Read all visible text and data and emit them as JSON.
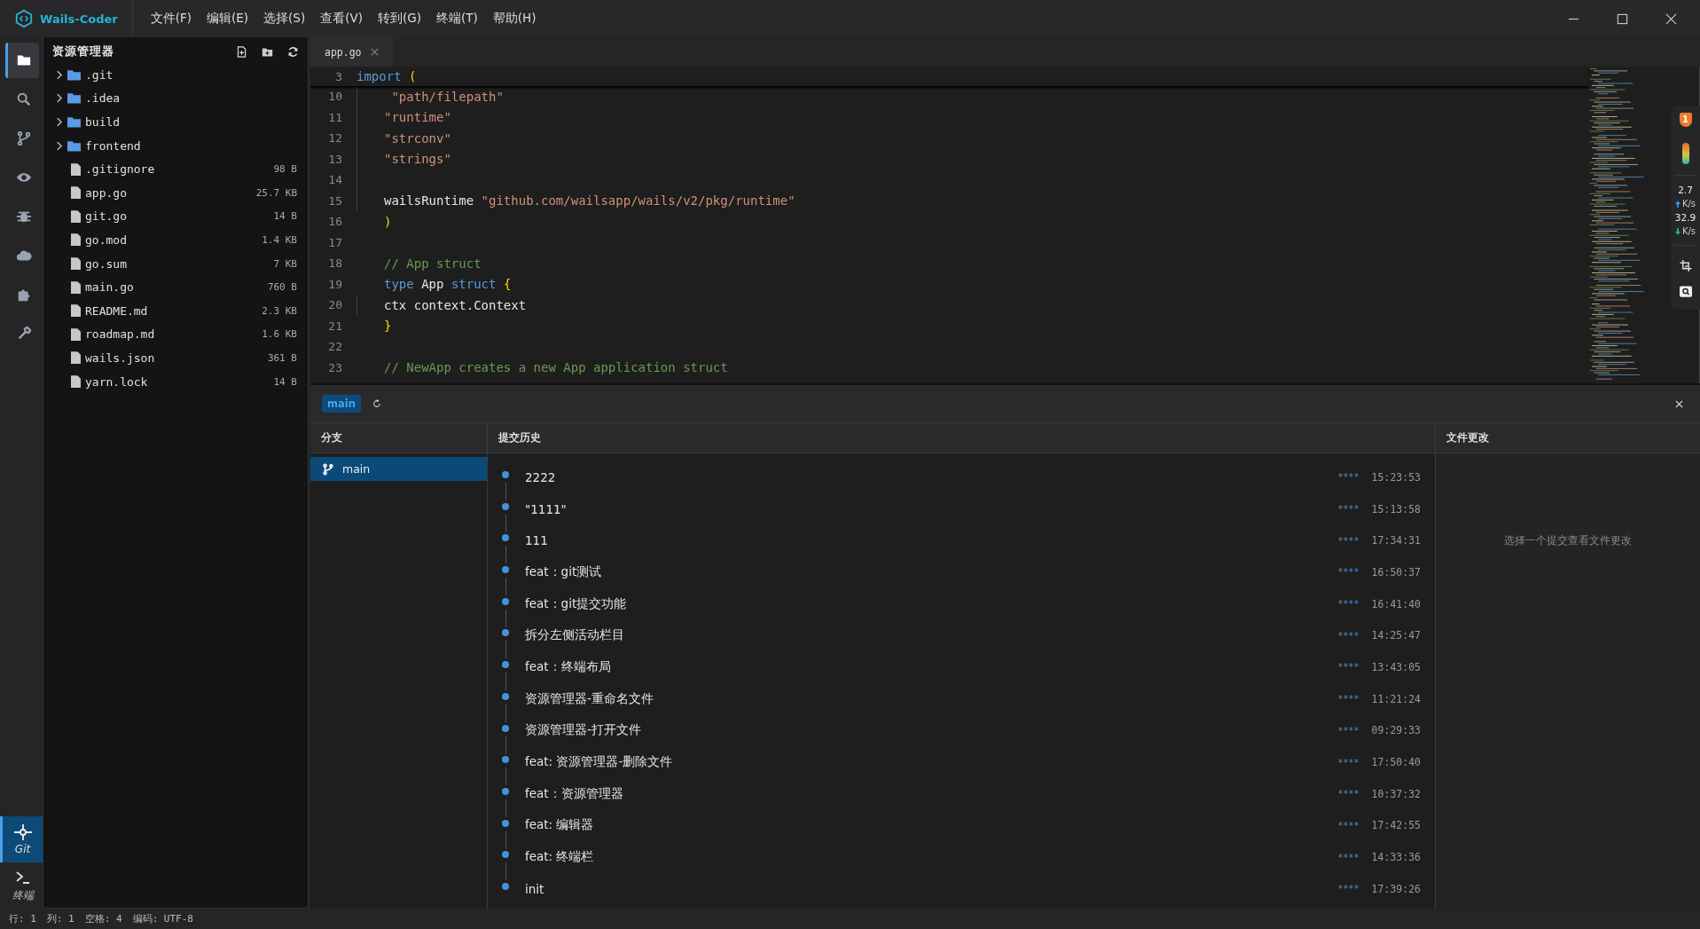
{
  "app": {
    "name": "Wails-Coder"
  },
  "menu": [
    "文件(F)",
    "编辑(E)",
    "选择(S)",
    "查看(V)",
    "转到(G)",
    "终端(T)",
    "帮助(H)"
  ],
  "activity_bar": {
    "top": [
      {
        "kind": "folder",
        "selected": true
      },
      {
        "kind": "search",
        "selected": false
      },
      {
        "kind": "branch",
        "selected": false
      },
      {
        "kind": "eye",
        "selected": false
      },
      {
        "kind": "bug",
        "selected": false
      },
      {
        "kind": "cloud",
        "selected": false
      },
      {
        "kind": "puzzle",
        "selected": false
      },
      {
        "kind": "wrench",
        "selected": false
      }
    ],
    "bottom": [
      {
        "kind": "git",
        "label": "Git",
        "selected": true
      },
      {
        "kind": "terminal",
        "label": "终端",
        "selected": false
      }
    ]
  },
  "explorer": {
    "title": "资源管理器",
    "items": [
      {
        "kind": "folder",
        "name": ".git",
        "expanded": false
      },
      {
        "kind": "folder",
        "name": ".idea",
        "expanded": false
      },
      {
        "kind": "folder",
        "name": "build",
        "expanded": false
      },
      {
        "kind": "folder",
        "name": "frontend",
        "expanded": false
      },
      {
        "kind": "file",
        "name": ".gitignore",
        "size": "98 B"
      },
      {
        "kind": "file",
        "name": "app.go",
        "size": "25.7 KB"
      },
      {
        "kind": "file",
        "name": "git.go",
        "size": "14 B"
      },
      {
        "kind": "file",
        "name": "go.mod",
        "size": "1.4 KB"
      },
      {
        "kind": "file",
        "name": "go.sum",
        "size": "7 KB"
      },
      {
        "kind": "file",
        "name": "main.go",
        "size": "760 B"
      },
      {
        "kind": "file",
        "name": "README.md",
        "size": "2.3 KB"
      },
      {
        "kind": "file",
        "name": "roadmap.md",
        "size": "1.6 KB"
      },
      {
        "kind": "file",
        "name": "wails.json",
        "size": "361 B"
      },
      {
        "kind": "file",
        "name": "yarn.lock",
        "size": "14 B"
      }
    ]
  },
  "tabs": [
    {
      "label": "app.go",
      "selected": true
    }
  ],
  "editor": {
    "sticky_line": {
      "number": "3",
      "tokens": [
        {
          "kind": "keyword",
          "text": "import"
        },
        {
          "kind": "paren",
          "text": " ("
        }
      ]
    },
    "lines": [
      {
        "number": "10",
        "indented": true,
        "tokens": [
          {
            "kind": "string",
            "text": " \"path/filepath\""
          }
        ]
      },
      {
        "number": "11",
        "indented": true,
        "tokens": [
          {
            "kind": "string",
            "text": "\"runtime\""
          }
        ]
      },
      {
        "number": "12",
        "indented": true,
        "tokens": [
          {
            "kind": "string",
            "text": "\"strconv\""
          }
        ]
      },
      {
        "number": "13",
        "indented": true,
        "tokens": [
          {
            "kind": "string",
            "text": "\"strings\""
          }
        ]
      },
      {
        "number": "14",
        "indented": true
      },
      {
        "number": "15",
        "indented": true,
        "tokens": [
          {
            "kind": "plain",
            "text": "wailsRuntime "
          },
          {
            "kind": "string",
            "text": "\"github.com/wailsapp/wails/v2/pkg/runtime\""
          }
        ]
      },
      {
        "number": "16",
        "indented": false,
        "tokens": [
          {
            "kind": "paren",
            "text": ")"
          }
        ]
      },
      {
        "number": "17",
        "indented": false
      },
      {
        "number": "18",
        "indented": false,
        "tokens": [
          {
            "kind": "comment",
            "text": "// App struct"
          }
        ]
      },
      {
        "number": "19",
        "indented": false,
        "tokens": [
          {
            "kind": "keyword",
            "text": "type"
          },
          {
            "kind": "plain",
            "text": " App "
          },
          {
            "kind": "keyword",
            "text": "struct"
          },
          {
            "kind": "paren",
            "text": " {"
          }
        ]
      },
      {
        "number": "20",
        "indented": true,
        "tokens": [
          {
            "kind": "plain",
            "text": "ctx context.Context"
          }
        ]
      },
      {
        "number": "21",
        "indented": false,
        "tokens": [
          {
            "kind": "paren",
            "text": "}"
          }
        ]
      },
      {
        "number": "22",
        "indented": false
      },
      {
        "number": "23",
        "indented": false,
        "tokens": [
          {
            "kind": "comment",
            "text": "// NewApp creates a new App application struct"
          }
        ]
      }
    ]
  },
  "float_widget": {
    "badge": "1",
    "upload": {
      "value": "2.7",
      "unit": "K/s"
    },
    "download": {
      "value": "32.9",
      "unit": "K/s"
    }
  },
  "git_panel": {
    "branch_badge": "main",
    "branches_header": "分支",
    "history_header": "提交历史",
    "changes_header": "文件更改",
    "branches": [
      {
        "name": "main",
        "selected": true
      }
    ],
    "commits": [
      {
        "message": "2222",
        "hash": "****",
        "time": "15:23:53"
      },
      {
        "message": "\"1111\"",
        "hash": "****",
        "time": "15:13:58"
      },
      {
        "message": "111",
        "hash": "****",
        "time": "17:34:31"
      },
      {
        "message": "feat：git测试",
        "hash": "****",
        "time": "16:50:37"
      },
      {
        "message": "feat：git提交功能",
        "hash": "****",
        "time": "16:41:40"
      },
      {
        "message": "拆分左侧活动栏目",
        "hash": "****",
        "time": "14:25:47"
      },
      {
        "message": "feat：终端布局",
        "hash": "****",
        "time": "13:43:05"
      },
      {
        "message": "资源管理器-重命名文件",
        "hash": "****",
        "time": "11:21:24"
      },
      {
        "message": "资源管理器-打开文件",
        "hash": "****",
        "time": "09:29:33"
      },
      {
        "message": "feat: 资源管理器-删除文件",
        "hash": "****",
        "time": "17:50:40"
      },
      {
        "message": "feat：资源管理器",
        "hash": "****",
        "time": "10:37:32"
      },
      {
        "message": "feat: 编辑器",
        "hash": "****",
        "time": "17:42:55"
      },
      {
        "message": "feat: 终端栏",
        "hash": "****",
        "time": "14:33:36"
      },
      {
        "message": "init",
        "hash": "****",
        "time": "17:39:26"
      }
    ],
    "changes_placeholder": "选择一个提交查看文件更改"
  },
  "status_bar": [
    "行: 1",
    "列: 1",
    "空格: 4",
    "编码: UTF-8"
  ]
}
